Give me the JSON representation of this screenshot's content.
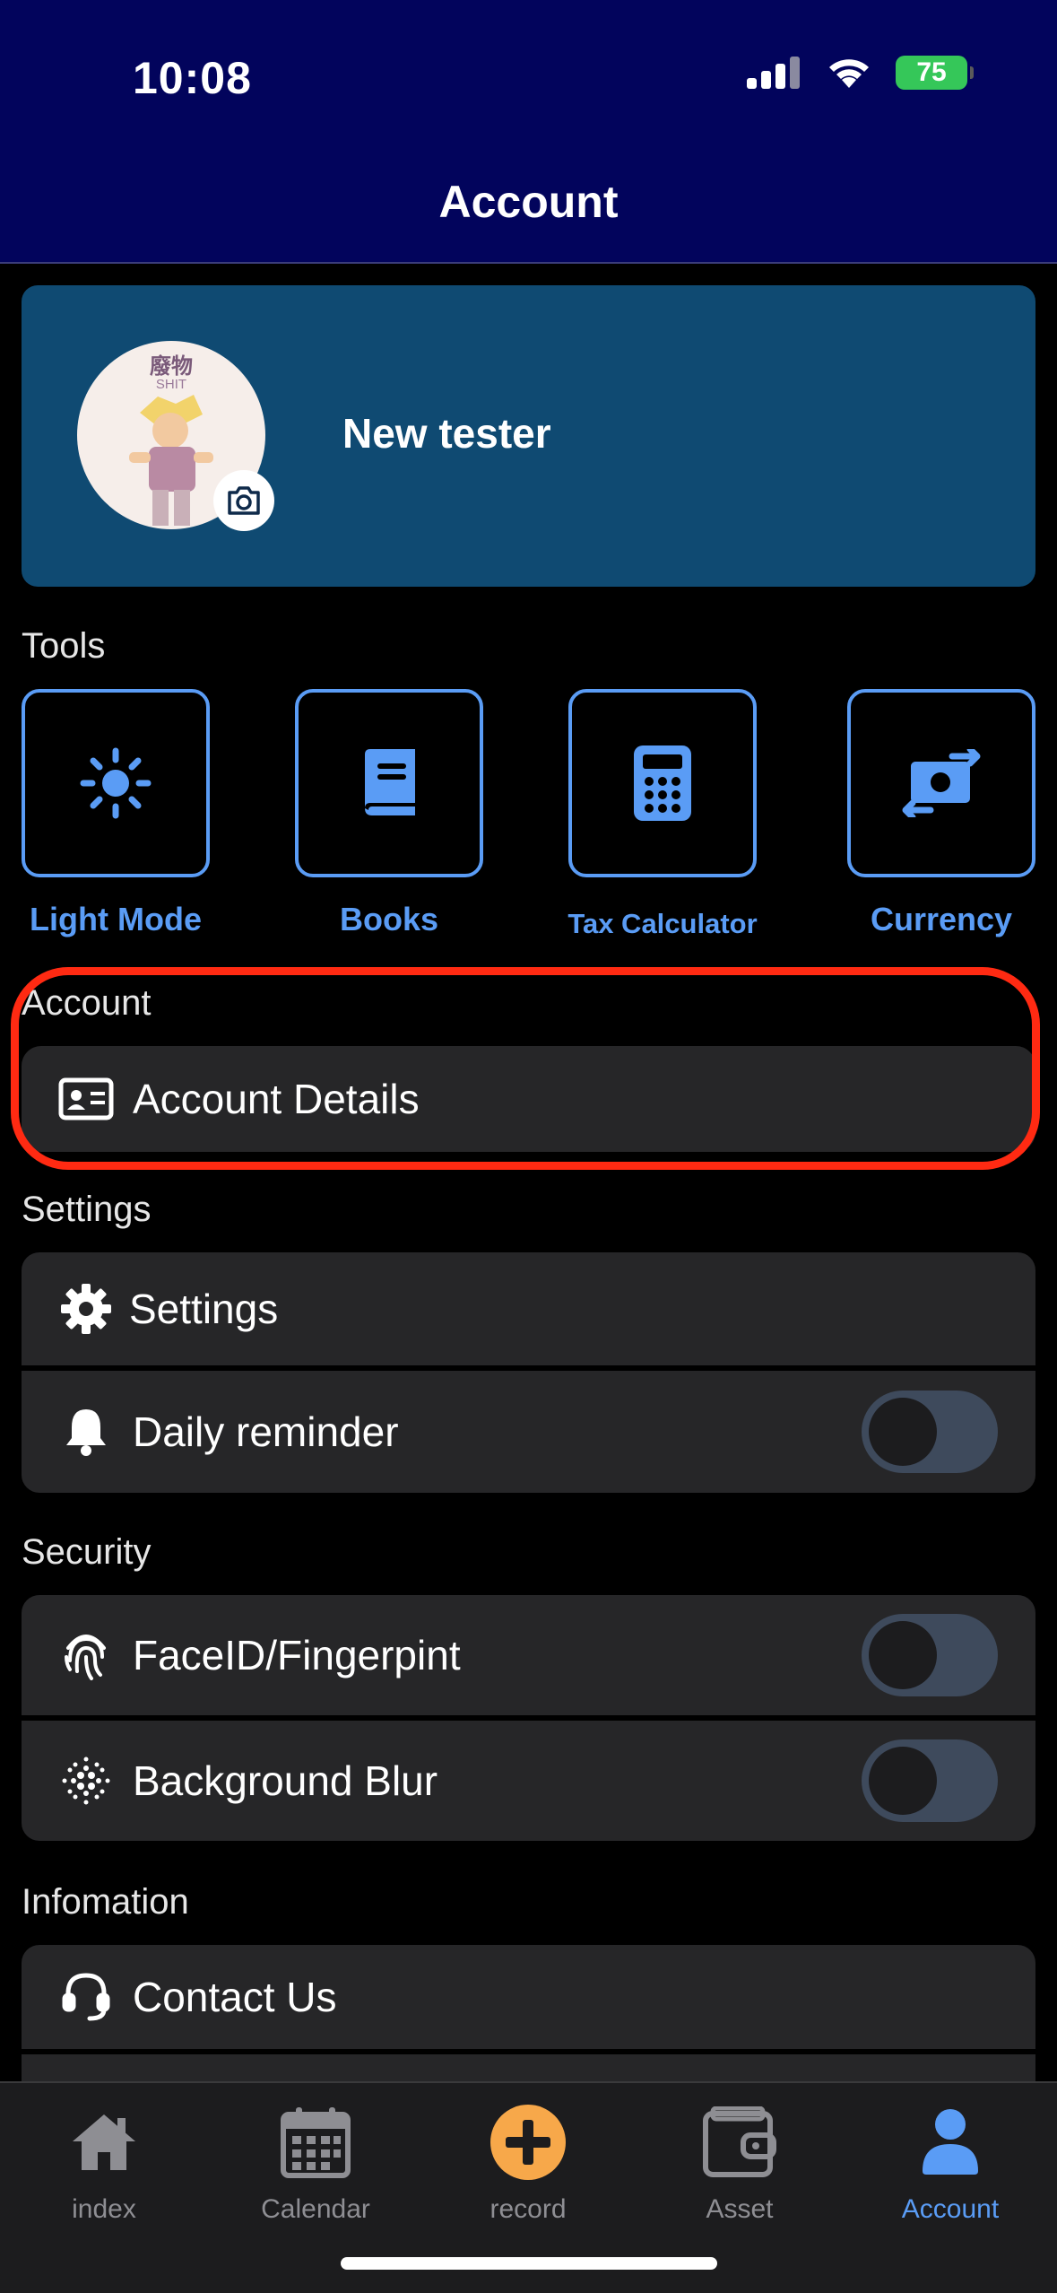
{
  "status_bar": {
    "time": "10:08",
    "battery": "75"
  },
  "header": {
    "title": "Account"
  },
  "profile": {
    "name": "New tester",
    "avatar_text_top": "廢物",
    "avatar_text_sub": "SHIT"
  },
  "sections": {
    "tools": "Tools",
    "account": "Account",
    "settings": "Settings",
    "security": "Security",
    "information": "Infomation"
  },
  "tools": [
    {
      "label": "Light Mode",
      "icon": "sun-icon"
    },
    {
      "label": "Books",
      "icon": "book-icon"
    },
    {
      "label": "Tax Calculator",
      "icon": "calculator-icon"
    },
    {
      "label": "Currency",
      "icon": "currency-exchange-icon"
    }
  ],
  "rows": {
    "account_details": "Account Details",
    "settings": "Settings",
    "daily_reminder": "Daily reminder",
    "faceid": "FaceID/Fingerpint",
    "background_blur": "Background Blur",
    "contact_us": "Contact Us"
  },
  "toggles": {
    "daily_reminder": false,
    "faceid": false,
    "background_blur": false
  },
  "tabs": [
    {
      "label": "index",
      "icon": "home-icon",
      "active": false
    },
    {
      "label": "Calendar",
      "icon": "calendar-icon",
      "active": false
    },
    {
      "label": "record",
      "icon": "plus-circle-icon",
      "active": false
    },
    {
      "label": "Asset",
      "icon": "wallet-icon",
      "active": false
    },
    {
      "label": "Account",
      "icon": "user-icon",
      "active": true
    }
  ],
  "colors": {
    "header_bg": "#02045c",
    "profile_card_bg": "#0f4a72",
    "accent": "#5a9cf5",
    "highlight_border": "#ff2a12",
    "record_button": "#f7a84a"
  }
}
